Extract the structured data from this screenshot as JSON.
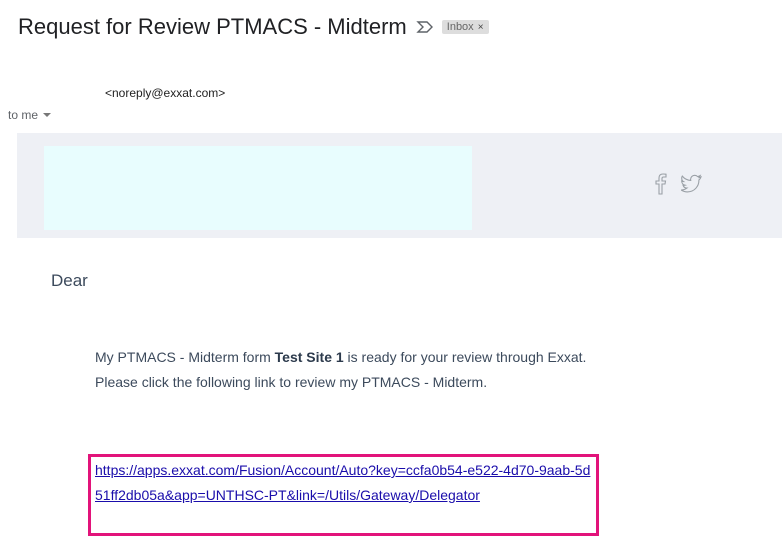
{
  "email": {
    "subject": "Request for Review PTMACS - Midterm",
    "label": "Inbox",
    "label_close": "×",
    "sender": "<noreply@exxat.com>",
    "recipient": "to me",
    "icons": {
      "importance": "importance-marker-icon",
      "facebook": "facebook-icon",
      "twitter": "twitter-icon",
      "dropdown": "caret-down-icon"
    }
  },
  "body": {
    "greeting": "Dear",
    "paragraph_before": "My PTMACS - Midterm form ",
    "paragraph_bold": "Test Site 1",
    "paragraph_after": " is ready for your review through Exxat. Please click the following link to review my PTMACS - Midterm.",
    "link": "https://apps.exxat.com/Fusion/Account/Auto?key=ccfa0b54-e522-4d70-9aab-5d51ff2db05a&app=UNTHSC-PT&link=/Utils/Gateway/Delegator"
  },
  "colors": {
    "header_band": "#eef0f5",
    "logo_area": "#e8fdfe",
    "highlight_border": "#e2137a",
    "link": "#1a0dab"
  }
}
